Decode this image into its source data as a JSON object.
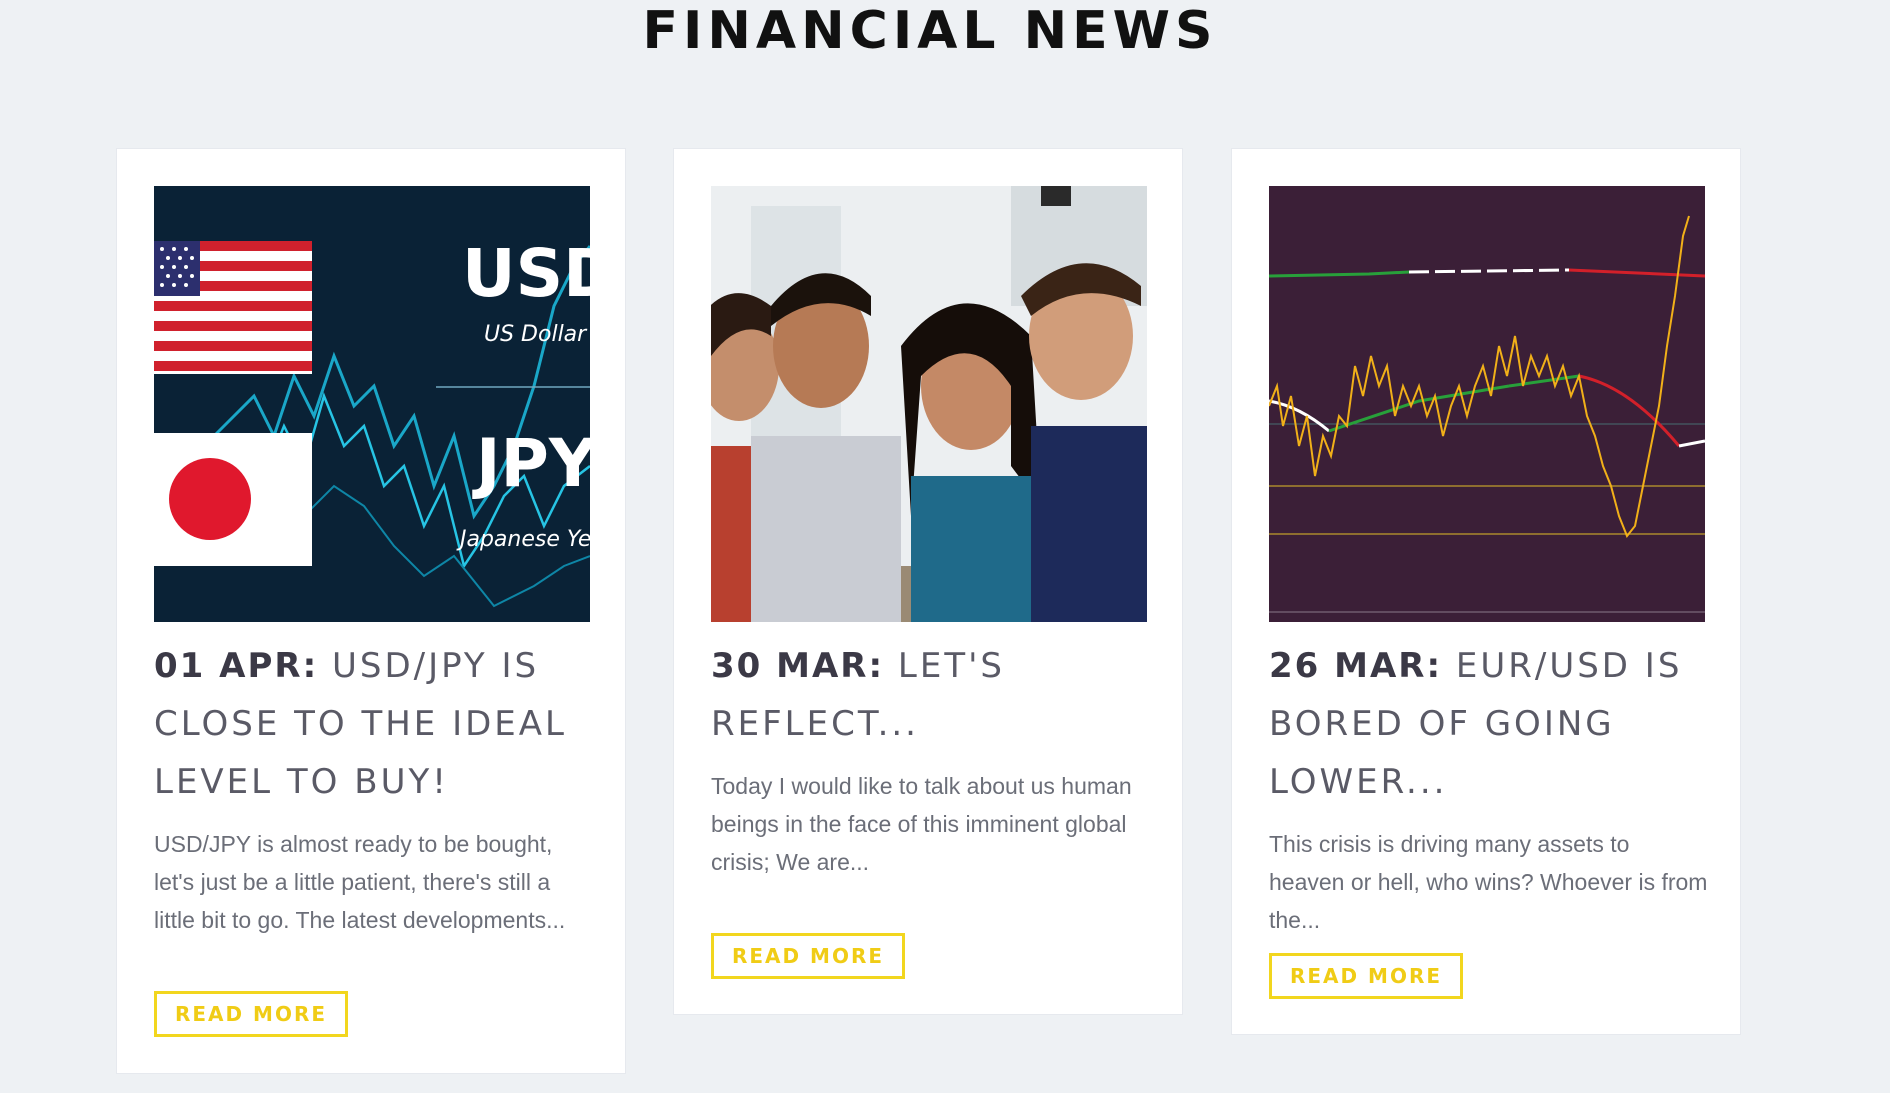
{
  "section": {
    "title": "FINANCIAL NEWS"
  },
  "articles": [
    {
      "date": "01 APR:",
      "title": "USD/JPY IS CLOSE TO THE IDEAL LEVEL TO BUY!",
      "excerpt": "USD/JPY is almost ready to be bought, let's just be a little patient, there's still a little bit to go. The latest developments...",
      "button": "READ MORE",
      "image": {
        "label_top": "USD",
        "label_top_sub": "US Dollar",
        "label_bottom": "JPY",
        "label_bottom_sub": "Japanese Yen"
      }
    },
    {
      "date": "30 MAR:",
      "title": "LET'S REFLECT...",
      "excerpt": "Today I would like to talk about us human beings in the face of this imminent global crisis; We are...",
      "button": "READ MORE"
    },
    {
      "date": "26 MAR:",
      "title": "EUR/USD IS BORED OF GOING LOWER...",
      "excerpt": "This crisis is driving many assets to heaven or hell, who wins? Whoever is from the...",
      "button": "READ MORE"
    }
  ],
  "colors": {
    "background": "#eef1f4",
    "accent": "#f2d61e",
    "title": "#111111",
    "text": "#6b6e78"
  }
}
